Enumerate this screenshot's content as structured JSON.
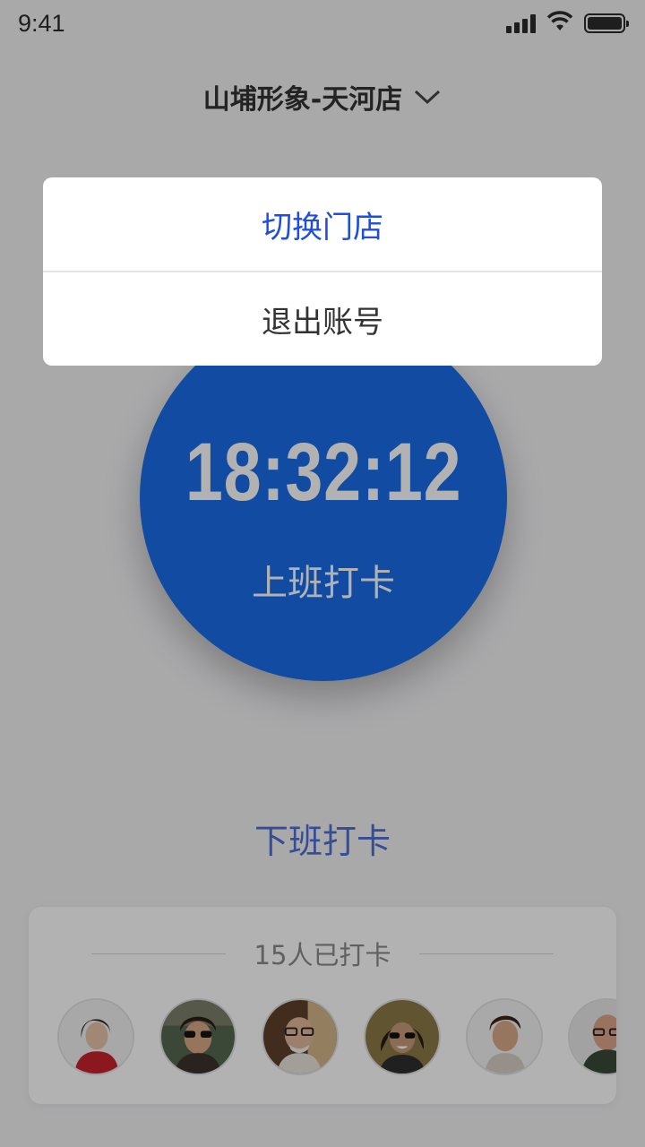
{
  "status_bar": {
    "time": "9:41",
    "icons": [
      "signal-icon",
      "wifi-icon",
      "battery-icon"
    ]
  },
  "header": {
    "store_name": "山埔形象-天河店",
    "dropdown_icon": "chevron-down-icon"
  },
  "clock": {
    "time": "18:32:12",
    "action_label": "上班打卡",
    "color": "#1a6ee8"
  },
  "clock_out": {
    "label": "下班打卡"
  },
  "punched": {
    "summary": "15人已打卡",
    "avatars": [
      "avatar-1",
      "avatar-2",
      "avatar-3",
      "avatar-4",
      "avatar-5",
      "avatar-6"
    ]
  },
  "menu": {
    "items": [
      {
        "label": "切换门店",
        "color": "#1e4de0"
      },
      {
        "label": "退出账号",
        "color": "#333333"
      }
    ]
  },
  "overlay": {
    "dimmed": true
  }
}
